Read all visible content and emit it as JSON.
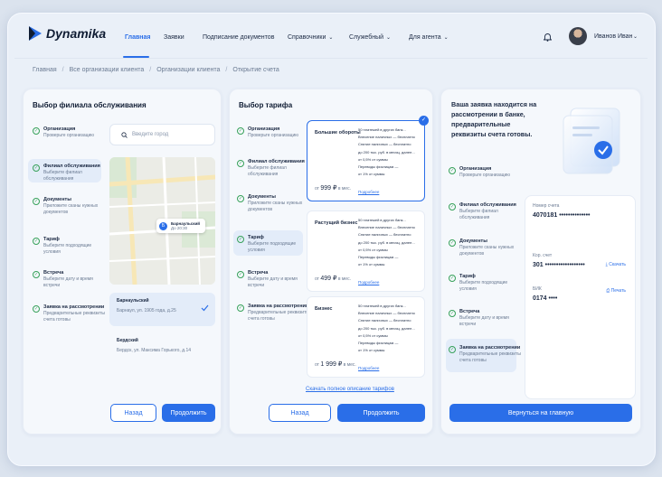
{
  "header": {
    "logo": "Dynamika",
    "nav": [
      "Главная",
      "Заявки",
      "Подписание документов",
      "Справочники",
      "Служебный",
      "Для агента"
    ],
    "user": "Иванов Иван"
  },
  "breadcrumb": [
    "Главная",
    "Все организации клиента",
    "Организации клиента",
    "Открытие счета"
  ],
  "left": {
    "title": "Выбор филиала обслуживания",
    "search_placeholder": "Введите город",
    "steps": [
      {
        "t": "Организация",
        "d": "Проверьте организацию"
      },
      {
        "t": "Филиал обслуживания",
        "d": "Выберите филиал обслуживания"
      },
      {
        "t": "Документы",
        "d": "Приложите сканы нужных документов"
      },
      {
        "t": "Тариф",
        "d": "Выберите подходящие условия"
      },
      {
        "t": "Встреча",
        "d": "Выберите дату и время встречи"
      },
      {
        "t": "Заявка на рассмотрении",
        "d": "Предварительные реквизиты счета готовы"
      }
    ],
    "map_pin": {
      "name": "Барнаульский",
      "hours": "До 20:30"
    },
    "branches": [
      {
        "name": "Барнаульский",
        "addr": "Барнаул, ул. 1905 года, д.25"
      },
      {
        "name": "Бердский",
        "addr": "Бердск, ул. Максима Горького, д.14"
      }
    ],
    "back": "Назад",
    "next": "Продолжить"
  },
  "mid": {
    "title": "Выбор тарифа",
    "steps": [
      {
        "t": "Организация",
        "d": "Проверьте организацию"
      },
      {
        "t": "Филиал обслуживания",
        "d": "Выберите филиал обслуживания"
      },
      {
        "t": "Документы",
        "d": "Приложите сканы нужных документов"
      },
      {
        "t": "Тариф",
        "d": "Выберите подходящие условия"
      },
      {
        "t": "Встреча",
        "d": "Выберите дату и время встречи"
      },
      {
        "t": "Заявка на рассмотрении",
        "d": "Предварительные реквизиты счета готовы"
      }
    ],
    "tariffs": [
      {
        "name": "Большие обороты",
        "from": "от",
        "price": "999 ₽",
        "per": "в мес.",
        "features": [
          "50 платежей в других банк...",
          "Внесение наличных — бесплатно",
          "Снятие наличных — бесплатно",
          "до 200 тыс. руб. в месяц, далее...",
          "от 0,5% от суммы",
          "Переводы физлицам —",
          "от 1% от суммы"
        ],
        "more": "Подробнее"
      },
      {
        "name": "Растущий бизнес",
        "from": "от",
        "price": "499 ₽",
        "per": "в мес.",
        "features": [
          "50 платежей в других банк...",
          "Внесение наличных — бесплатно",
          "Снятие наличных — бесплатно",
          "до 200 тыс. руб. в месяц, далее...",
          "от 0,5% от суммы",
          "Переводы физлицам —",
          "от 1% от суммы"
        ],
        "more": "Подробнее"
      },
      {
        "name": "Бизнес",
        "from": "от",
        "price": "1 999 ₽",
        "per": "в мес.",
        "features": [
          "50 платежей в других банк...",
          "Внесение наличных — бесплатно",
          "Снятие наличных — бесплатно",
          "до 200 тыс. руб. в месяц, далее...",
          "от 0,5% от суммы",
          "Переводы физлицам —",
          "от 1% от суммы"
        ],
        "more": "Подробнее"
      }
    ],
    "full_link": "Скачать полное описание тарифов",
    "back": "Назад",
    "next": "Продолжить"
  },
  "right": {
    "title": "Ваша заявка находится на рассмотрении в банке, предварительные реквизиты счета готовы.",
    "steps": [
      {
        "t": "Организация",
        "d": "Проверьте организацию"
      },
      {
        "t": "Филиал обслуживания",
        "d": "Выберите филиал обслуживания"
      },
      {
        "t": "Документы",
        "d": "Приложите сканы нужных документов"
      },
      {
        "t": "Тариф",
        "d": "Выберите подходящие условия"
      },
      {
        "t": "Встреча",
        "d": "Выберите дату и время встречи"
      },
      {
        "t": "Заявка на рассмотрении",
        "d": "Предварительные реквизиты счета готовы"
      }
    ],
    "account_label": "Номер счета",
    "account": "4070181 ••••••••••••••",
    "kor_label": "Кор. счет",
    "kor": "301 ••••••••••••••••••",
    "bik_label": "БИК",
    "bik": "0174 ••••",
    "download": "Скачать",
    "print": "Печать",
    "home": "Вернуться на главную"
  },
  "colors": {
    "accent": "#2a6ee8",
    "done": "#37a15a"
  }
}
